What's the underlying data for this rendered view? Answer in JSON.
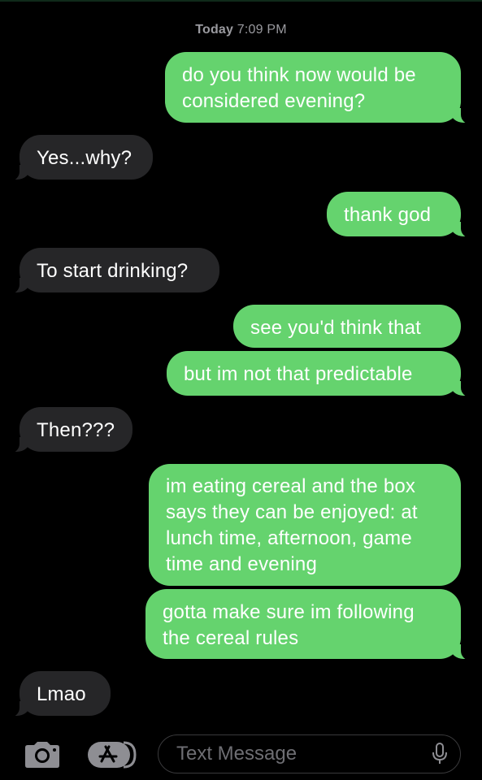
{
  "conversation": {
    "timestamp_day": "Today",
    "timestamp_time": "7:09 PM",
    "messages": [
      {
        "from": "me",
        "text": "do you think now would be\nconsidered evening?"
      },
      {
        "from": "them",
        "text": "Yes...why?"
      },
      {
        "from": "me",
        "text": "thank god"
      },
      {
        "from": "them",
        "text": "To start drinking?"
      },
      {
        "from": "me",
        "text": "see you'd think that"
      },
      {
        "from": "me",
        "text": "but im not that predictable"
      },
      {
        "from": "them",
        "text": "Then???"
      },
      {
        "from": "me",
        "text": "im eating cereal and the box\nsays they can be enjoyed: at\nlunch time, afternoon, game\ntime and evening"
      },
      {
        "from": "me",
        "text": "gotta make sure im following\nthe cereal rules"
      },
      {
        "from": "them",
        "text": "Lmao"
      }
    ]
  },
  "input_bar": {
    "placeholder": "Text Message",
    "camera_icon": "camera-icon",
    "app_icon": "app-store-icon",
    "mic_icon": "microphone-icon"
  },
  "colors": {
    "sent_bubble": "#65d36e",
    "received_bubble": "#262628",
    "background": "#000000",
    "timestamp": "#9a9a9f"
  }
}
